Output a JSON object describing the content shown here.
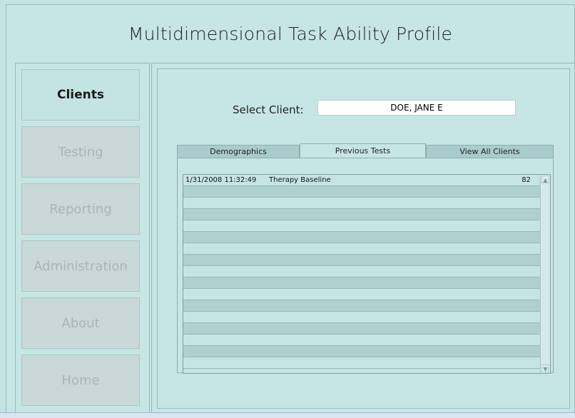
{
  "app": {
    "title": "Multidimensional Task Ability Profile"
  },
  "sidebar": {
    "items": [
      {
        "label": "Clients",
        "active": true
      },
      {
        "label": "Testing",
        "active": false
      },
      {
        "label": "Reporting",
        "active": false
      },
      {
        "label": "Administration",
        "active": false
      },
      {
        "label": "About",
        "active": false
      },
      {
        "label": "Home",
        "active": false
      }
    ]
  },
  "client": {
    "label": "Select Client:",
    "value": "DOE, JANE E"
  },
  "tabs": [
    {
      "label": "Demographics",
      "active": false
    },
    {
      "label": "Previous Tests",
      "active": true
    },
    {
      "label": "View All Clients",
      "active": false
    }
  ],
  "tests": {
    "rows": [
      {
        "timestamp": "1/31/2008 11:32:49",
        "name": "Therapy Baseline",
        "score": "82"
      }
    ]
  },
  "colors": {
    "background": "#c5e6e5",
    "row_alt": "#aed0cf",
    "disabled_text": "#a9b5b5"
  }
}
